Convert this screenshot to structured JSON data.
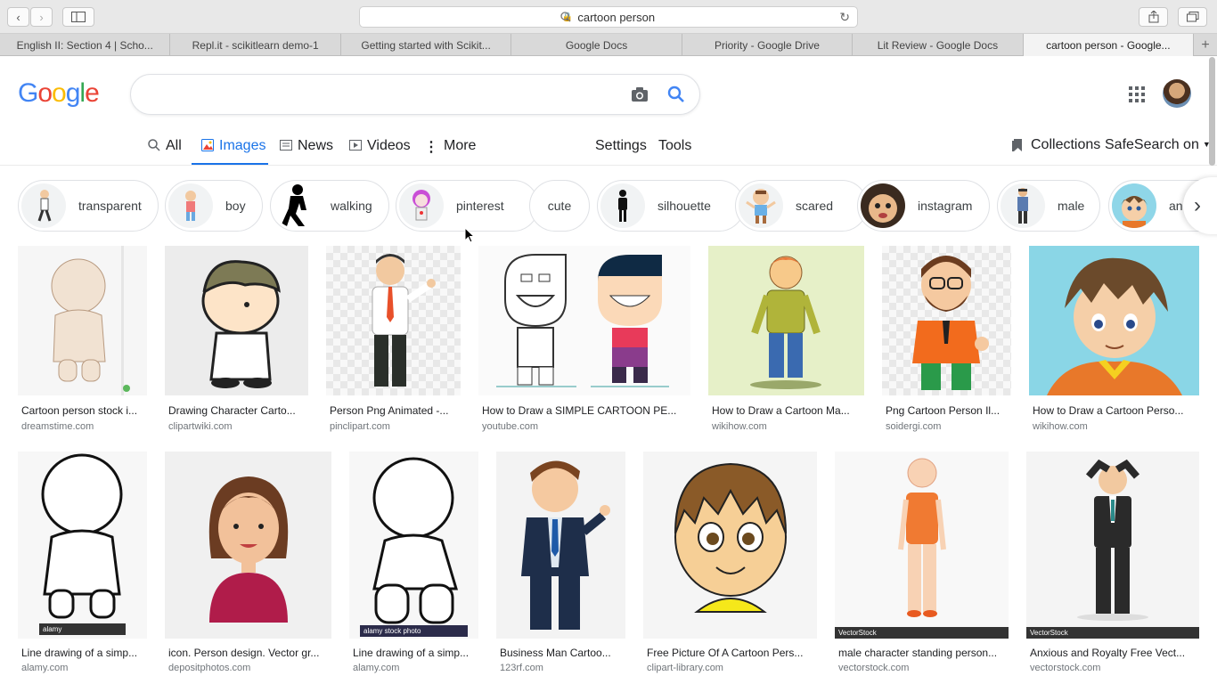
{
  "browser": {
    "url": "cartoon person",
    "tabs": [
      {
        "label": "English II: Section 4 | Scho..."
      },
      {
        "label": "Repl.it - scikitlearn demo-1"
      },
      {
        "label": "Getting started with Scikit..."
      },
      {
        "label": "Google Docs"
      },
      {
        "label": "Priority - Google Drive"
      },
      {
        "label": "Lit Review - Google Docs"
      },
      {
        "label": "cartoon person - Google..."
      }
    ],
    "new_tab": "+"
  },
  "google": {
    "logo_letters": [
      "G",
      "o",
      "o",
      "g",
      "l",
      "e"
    ],
    "logo_colors": [
      "#4285f4",
      "#ea4335",
      "#fbbc05",
      "#4285f4",
      "#34a853",
      "#ea4335"
    ],
    "search_value": "",
    "accent": "#1a73e8"
  },
  "nav": {
    "all": "All",
    "images": "Images",
    "news": "News",
    "videos": "Videos",
    "more": "More",
    "settings": "Settings",
    "tools": "Tools",
    "collections": "Collections",
    "safesearch": "SafeSearch on"
  },
  "chips": [
    {
      "label": "transparent",
      "icon": "stick-figure-icon"
    },
    {
      "label": "boy",
      "icon": "boy-icon"
    },
    {
      "label": "walking",
      "icon": "walking-silhouette-icon"
    },
    {
      "label": "pinterest",
      "icon": "girl-icon"
    },
    {
      "label": "cute",
      "icon": ""
    },
    {
      "label": "silhouette",
      "icon": "person-silhouette-icon"
    },
    {
      "label": "scared",
      "icon": "scared-icon"
    },
    {
      "label": "instagram",
      "icon": "face-icon"
    },
    {
      "label": "male",
      "icon": "man-icon"
    },
    {
      "label": "ani",
      "icon": "anime-face-icon"
    }
  ],
  "results_row1": [
    {
      "title": "Cartoon person stock i...",
      "source": "dreamstime.com"
    },
    {
      "title": "Drawing Character Carto...",
      "source": "clipartwiki.com"
    },
    {
      "title": "Person Png Animated -...",
      "source": "pinclipart.com"
    },
    {
      "title": "How to Draw a SIMPLE CARTOON PE...",
      "source": "youtube.com"
    },
    {
      "title": "How to Draw a Cartoon Ma...",
      "source": "wikihow.com"
    },
    {
      "title": "Png Cartoon Person Il...",
      "source": "soidergi.com"
    },
    {
      "title": "How to Draw a Cartoon Perso...",
      "source": "wikihow.com"
    }
  ],
  "results_row2": [
    {
      "title": "Line drawing of a simp...",
      "source": "alamy.com",
      "badge": "alamy"
    },
    {
      "title": "icon. Person design. Vector gr...",
      "source": "depositphotos.com",
      "badge": ""
    },
    {
      "title": "Line drawing of a simp...",
      "source": "alamy.com",
      "badge": "alamy stock photo"
    },
    {
      "title": "Business Man Cartoo...",
      "source": "123rf.com",
      "badge": ""
    },
    {
      "title": "Free Picture Of A Cartoon Pers...",
      "source": "clipart-library.com",
      "badge": ""
    },
    {
      "title": "male character standing person...",
      "source": "vectorstock.com",
      "badge": "VectorStock"
    },
    {
      "title": "Anxious and Royalty Free Vect...",
      "source": "vectorstock.com",
      "badge": "VectorStock"
    }
  ]
}
